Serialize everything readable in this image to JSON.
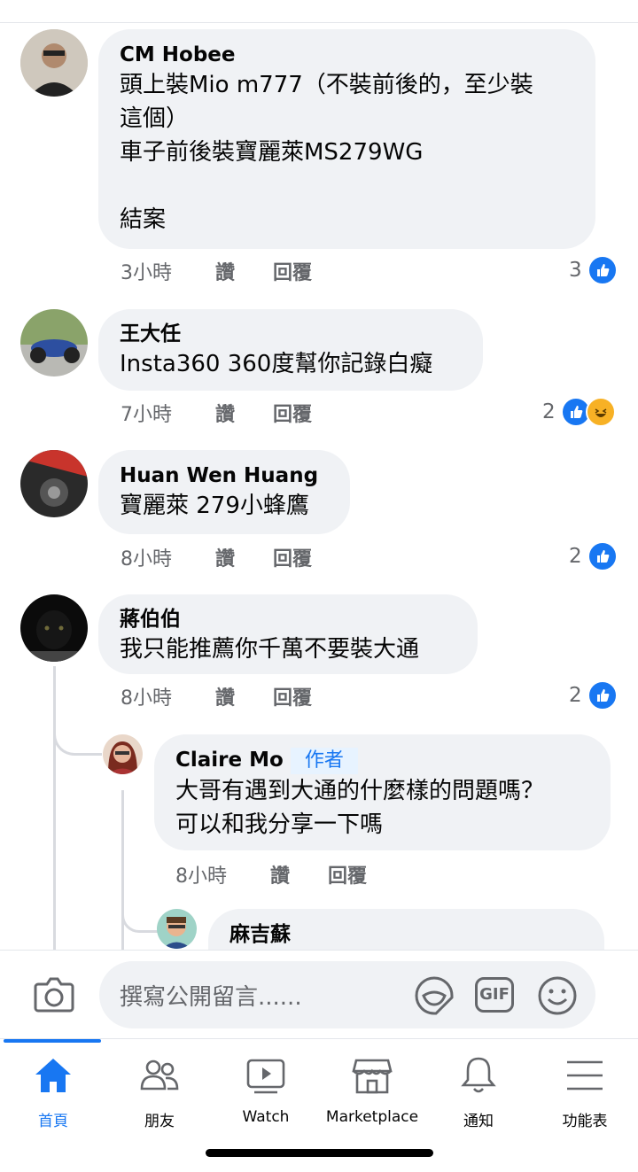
{
  "comments": [
    {
      "name": "CM Hobee",
      "text": "頭上裝Mio m777（不裝前後的，至少裝\n這個）\n車子前後裝寶麗萊MS279WG\n\n結案",
      "time": "3小時",
      "like_label": "讚",
      "reply_label": "回覆",
      "reaction_count": "3",
      "reactions": [
        "like-icon"
      ]
    },
    {
      "name": "王大任",
      "text": "Insta360 360度幫你記錄白癡",
      "time": "7小時",
      "like_label": "讚",
      "reply_label": "回覆",
      "reaction_count": "2",
      "reactions": [
        "like-icon",
        "haha-icon"
      ]
    },
    {
      "name": "Huan Wen Huang",
      "text": "寶麗萊 279小蜂鷹",
      "time": "8小時",
      "like_label": "讚",
      "reply_label": "回覆",
      "reaction_count": "2",
      "reactions": [
        "like-icon"
      ]
    },
    {
      "name": "蔣伯伯",
      "text": "我只能推薦你千萬不要裝大通",
      "time": "8小時",
      "like_label": "讚",
      "reply_label": "回覆",
      "reaction_count": "2",
      "reactions": [
        "like-icon"
      ]
    }
  ],
  "replies": [
    {
      "name": "Claire Mo",
      "badge": "作者",
      "text": "大哥有遇到大通的什麼樣的問題嗎？\n可以和我分享一下嗎",
      "time": "8小時",
      "like_label": "讚",
      "reply_label": "回覆"
    },
    {
      "name": "麻吉蘇"
    }
  ],
  "composer": {
    "placeholder": "撰寫公開留言......",
    "icons": [
      "camera-icon",
      "sticker-icon",
      "gif-icon",
      "emoji-icon"
    ],
    "gif_label": "GIF"
  },
  "tabs": [
    {
      "label": "首頁",
      "icon": "home-icon",
      "active": true
    },
    {
      "label": "朋友",
      "icon": "friends-icon"
    },
    {
      "label": "Watch",
      "icon": "watch-icon"
    },
    {
      "label": "Marketplace",
      "icon": "marketplace-icon"
    },
    {
      "label": "通知",
      "icon": "bell-icon"
    },
    {
      "label": "功能表",
      "icon": "menu-icon"
    }
  ],
  "colors": {
    "accent": "#1877f2",
    "bubble": "#f0f2f5",
    "meta": "#65676b"
  }
}
